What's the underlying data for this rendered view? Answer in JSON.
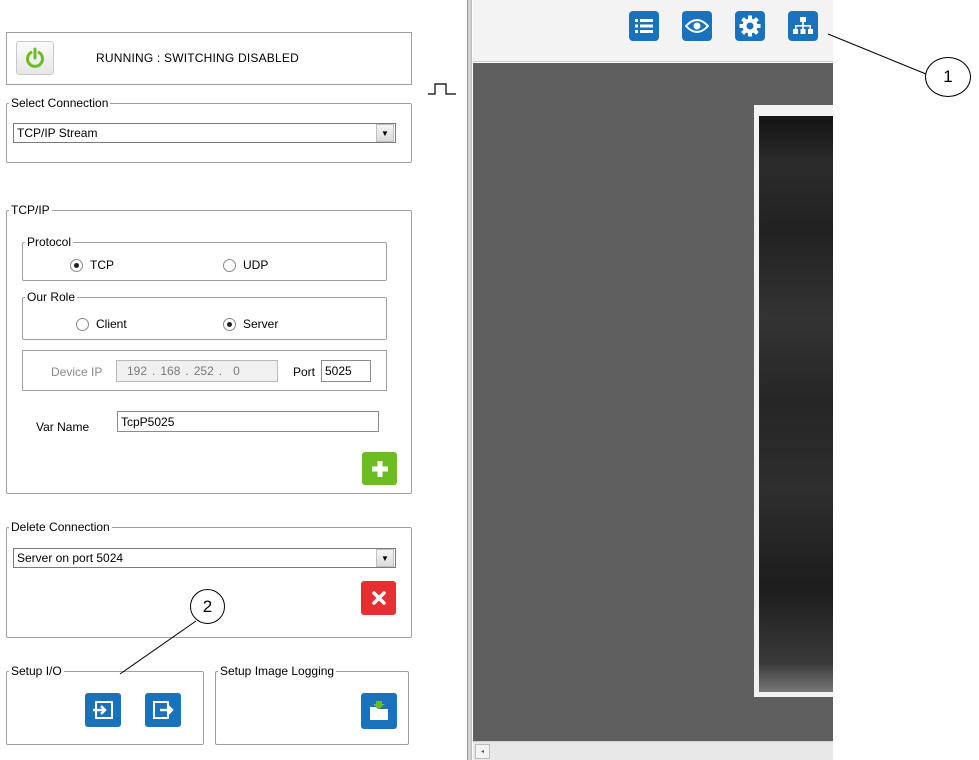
{
  "status": {
    "text": "RUNNING : SWITCHING DISABLED"
  },
  "select_connection": {
    "legend": "Select Connection",
    "value": "TCP/IP Stream"
  },
  "tcpip": {
    "legend": "TCP/IP",
    "protocol": {
      "legend": "Protocol",
      "options": [
        "TCP",
        "UDP"
      ],
      "selected": "TCP"
    },
    "role": {
      "legend": "Our Role",
      "options": [
        "Client",
        "Server"
      ],
      "selected": "Server"
    },
    "device_ip": {
      "label": "Device IP",
      "octets": [
        "192",
        "168",
        "252",
        "0"
      ]
    },
    "port": {
      "label": "Port",
      "value": "5025"
    },
    "var_name": {
      "label": "Var Name",
      "value": "TcpP5025"
    }
  },
  "delete_connection": {
    "legend": "Delete Connection",
    "value": "Server on port 5024"
  },
  "setup_io": {
    "legend": "Setup I/O"
  },
  "setup_image_logging": {
    "legend": "Setup Image Logging"
  },
  "callouts": [
    "1",
    "2"
  ],
  "toolbar": {
    "icons": [
      "list-icon",
      "eye-icon",
      "gear-icon",
      "network-icon"
    ]
  },
  "colors": {
    "accent_blue": "#1a72bd",
    "add_green": "#6cbd24",
    "delete_red": "#e52f30",
    "power_green": "#6cbd24",
    "viewer_gray": "#5f5f5f"
  }
}
